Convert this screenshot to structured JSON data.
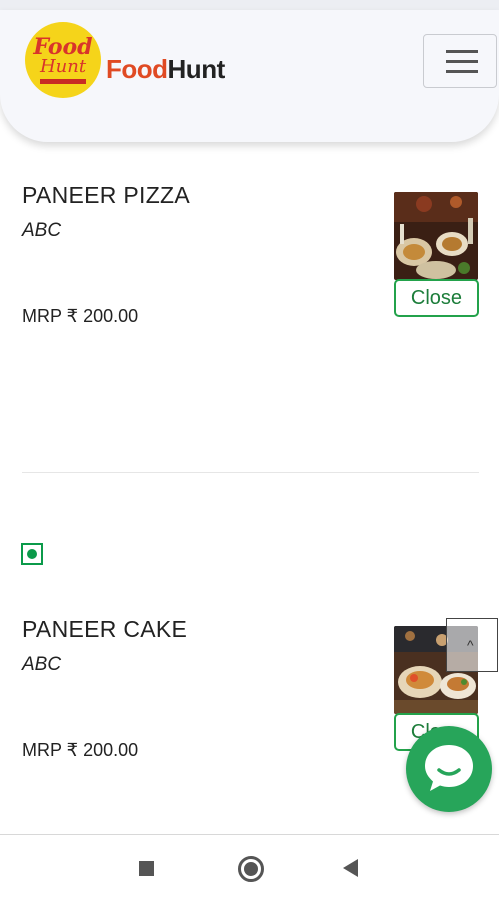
{
  "header": {
    "logo_line1": "Food",
    "logo_line2": "Hunt",
    "brand_part1": "Food",
    "brand_part2": "Hunt",
    "menu_icon": "hamburger-icon"
  },
  "items": [
    {
      "name": "PANEER PIZZA",
      "description": "ABC",
      "price": "MRP ₹ 200.00",
      "button_label": "Close"
    },
    {
      "name": "PANEER CAKE",
      "description": "ABC",
      "price": "MRP ₹ 200.00",
      "button_label": "Close"
    }
  ],
  "scroll_top_icon": "chevron-up-icon",
  "chat_icon": "chat-bubble-icon",
  "system_nav": {
    "recent_icon": "square-recents-icon",
    "home_icon": "circle-home-icon",
    "back_icon": "triangle-back-icon"
  },
  "colors": {
    "accent_green": "#23a24b",
    "brand_orange": "#e04a23",
    "logo_yellow": "#f5d41a"
  }
}
